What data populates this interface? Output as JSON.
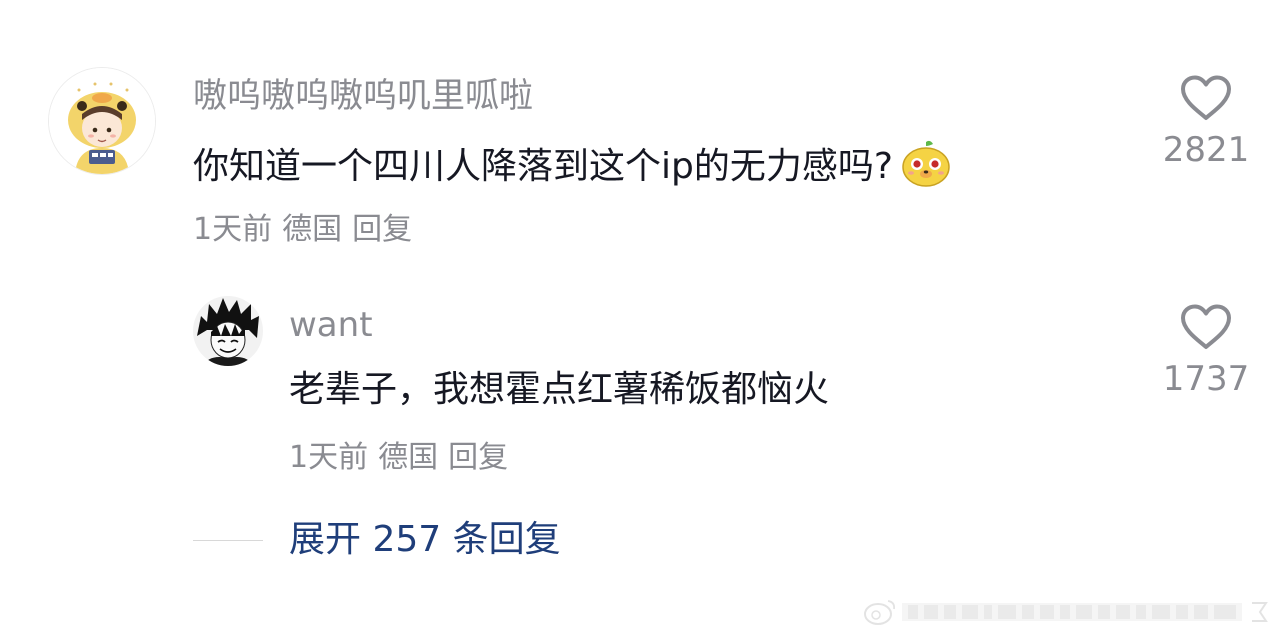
{
  "comment": {
    "username": "嗷呜嗷呜嗷呜叽里呱啦",
    "text": "你知道一个四川人降落到这个ip的无力感吗?",
    "emoji_icon": "yellow-blob-sticker-icon",
    "time": "1天前",
    "location": "德国",
    "reply_label": "回复",
    "likes": "2821"
  },
  "reply": {
    "username": "want",
    "text": "老辈子，我想霍点红薯稀饭都恼火",
    "time": "1天前",
    "location": "德国",
    "reply_label": "回复",
    "likes": "1737"
  },
  "expand": {
    "label": "展开 257 条回复"
  },
  "colors": {
    "text_primary": "#161823",
    "text_secondary": "#8a8b91",
    "link": "#1f3e7a",
    "divider": "#d8d8d8"
  },
  "icons": {
    "like": "heart-outline-icon",
    "watermark": "weibo-watermark-icon"
  }
}
